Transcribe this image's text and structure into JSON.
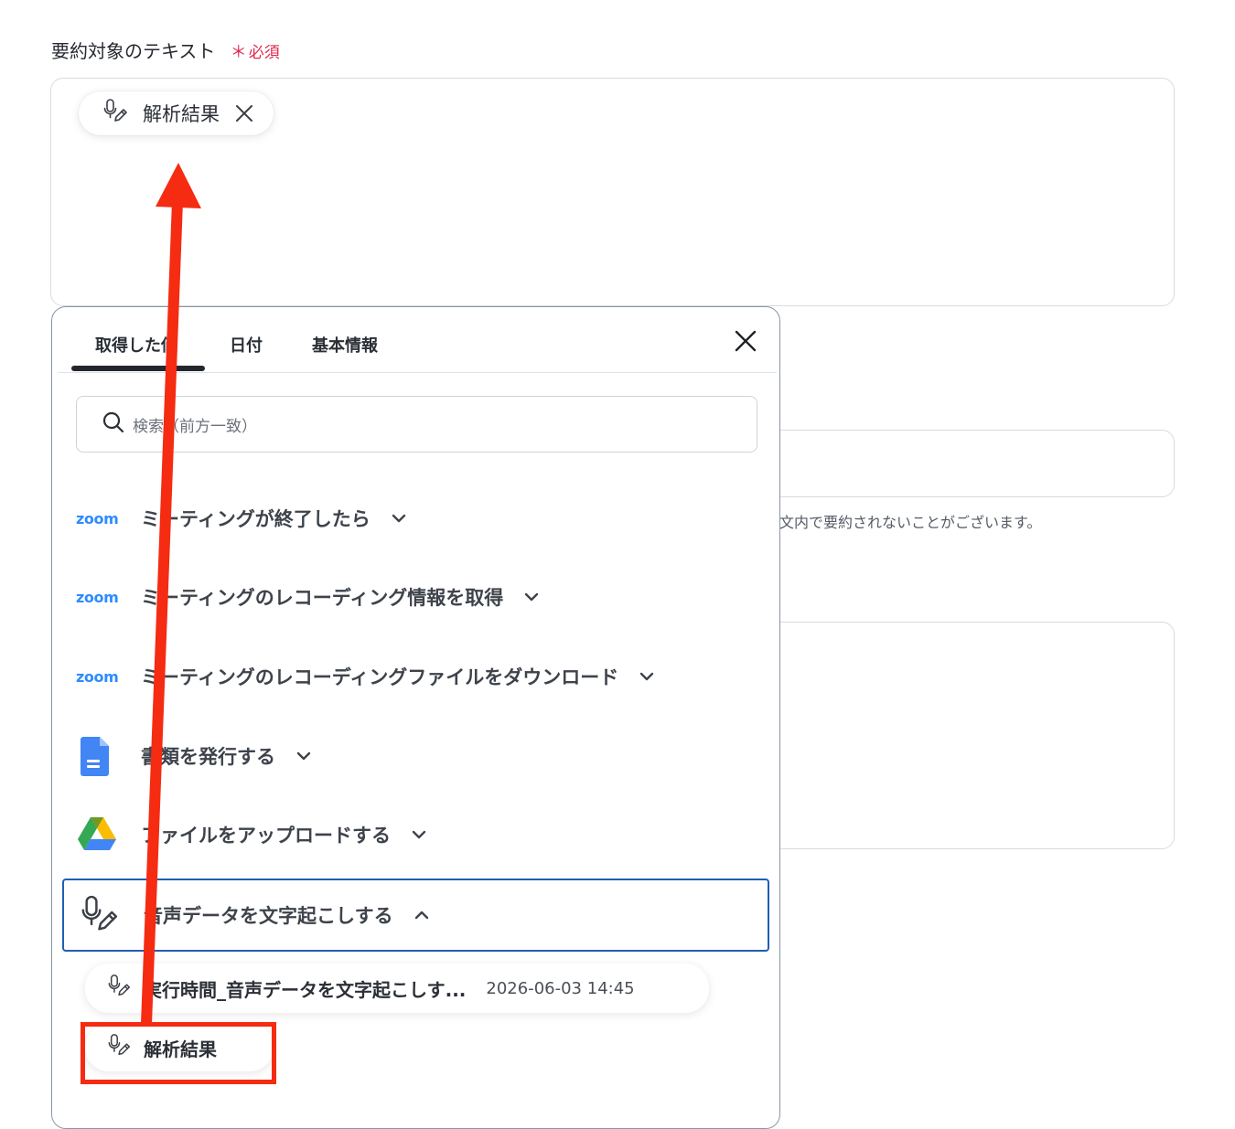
{
  "field": {
    "label": "要約対象のテキスト",
    "required": "必須",
    "required_star": "＊"
  },
  "inserted_chip": {
    "label": "解析結果",
    "icon": "mic-pen-icon"
  },
  "background": {
    "note_fragment": "文内で要約されないことがございます。"
  },
  "popup": {
    "tabs": [
      {
        "label": "取得した値",
        "active": true
      },
      {
        "label": "日付",
        "active": false
      },
      {
        "label": "基本情報",
        "active": false
      }
    ],
    "search_placeholder": "検索（前方一致）",
    "items": [
      {
        "icon": "zoom-logo",
        "icon_text": "zoom",
        "label": "ミーティングが終了したら",
        "expanded": false
      },
      {
        "icon": "zoom-logo",
        "icon_text": "zoom",
        "label": "ミーティングのレコーディング情報を取得",
        "expanded": false
      },
      {
        "icon": "zoom-logo",
        "icon_text": "zoom",
        "label": "ミーティングのレコーディングファイルをダウンロード",
        "expanded": false
      },
      {
        "icon": "google-docs-icon",
        "label": "書類を発行する",
        "expanded": false
      },
      {
        "icon": "google-drive-icon",
        "label": "ファイルをアップロードする",
        "expanded": false
      },
      {
        "icon": "mic-pen-icon",
        "label": "音声データを文字起こしする",
        "expanded": true
      }
    ],
    "sub_items": [
      {
        "label": "実行時間_音声データを文字起こしす...",
        "value": "2026-06-03 14:45"
      },
      {
        "label": "解析結果",
        "value": ""
      }
    ]
  },
  "colors": {
    "required": "#e0284f",
    "zoom": "#2d8cff",
    "selected_border": "#1f5fb4",
    "annotation": "#f52b12"
  }
}
